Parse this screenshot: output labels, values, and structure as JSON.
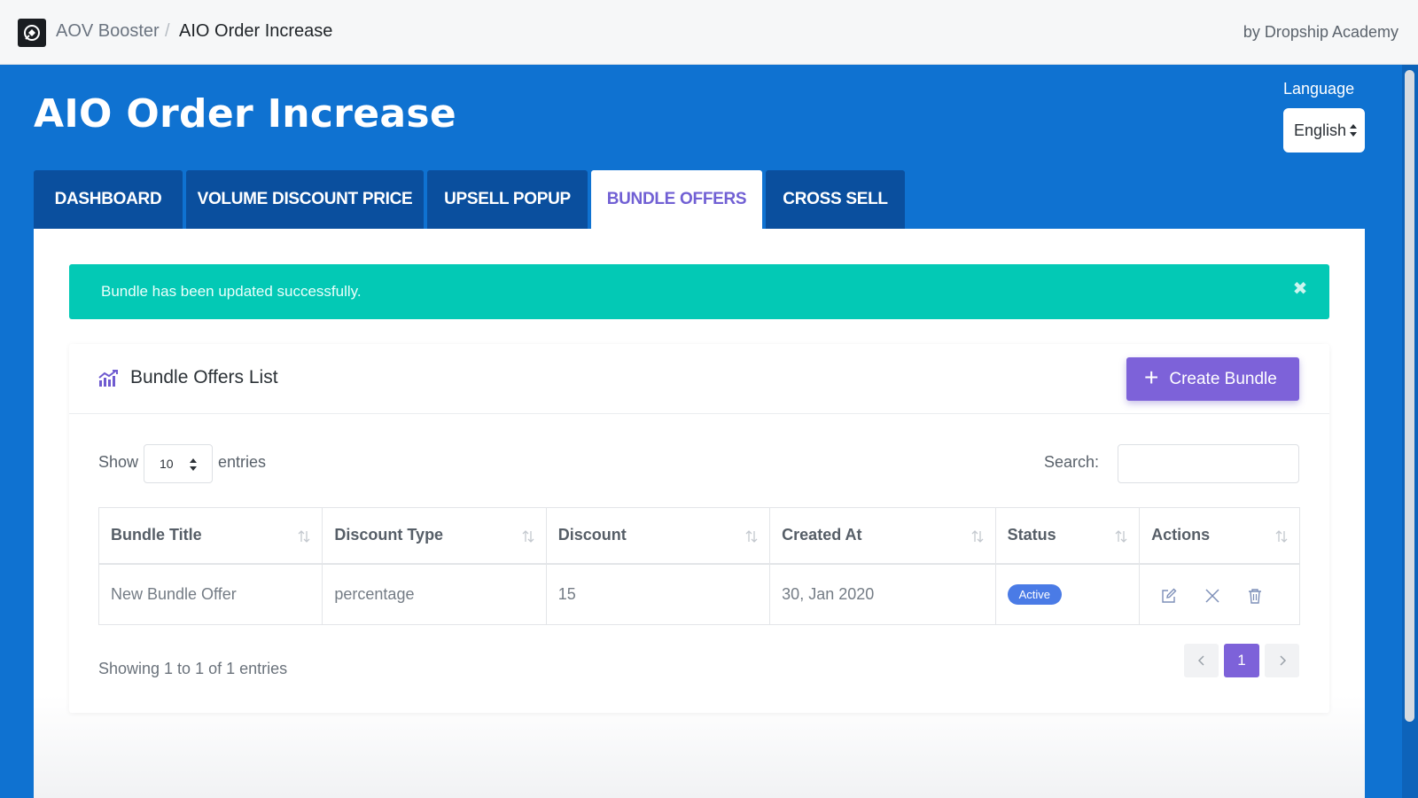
{
  "topbar": {
    "app_name": "AOV Booster",
    "separator": "/",
    "page_name": "AIO Order Increase",
    "by_text": "by Dropship Academy"
  },
  "header": {
    "title": "AIO Order Increase",
    "language_label": "Language",
    "language_value": "English"
  },
  "tabs": [
    {
      "label": "Dashboard",
      "active": false
    },
    {
      "label": "Volume Discount Price",
      "active": false
    },
    {
      "label": "Upsell Popup",
      "active": false
    },
    {
      "label": "Bundle Offers",
      "active": true
    },
    {
      "label": "Cross Sell",
      "active": false
    }
  ],
  "alert": {
    "message": "Bundle has been updated successfully.",
    "close_icon": "times-icon"
  },
  "card": {
    "title": "Bundle Offers List",
    "icon": "chart-icon",
    "create_button": "Create Bundle"
  },
  "table_controls": {
    "show_label": "Show",
    "entries_value": "10",
    "entries_label": "entries",
    "search_label": "Search:",
    "search_value": ""
  },
  "table": {
    "columns": [
      "Bundle Title",
      "Discount Type",
      "Discount",
      "Created At",
      "Status",
      "Actions"
    ],
    "rows": [
      {
        "title": "New Bundle Offer",
        "discount_type": "percentage",
        "discount": "15",
        "created_at": "30, Jan 2020",
        "status": "Active"
      }
    ]
  },
  "footer": {
    "showing": "Showing 1 to 1 of 1 entries",
    "current_page": "1"
  },
  "colors": {
    "brand_blue": "#0f72d1",
    "tab_dark": "#0a4f9e",
    "accent_purple": "#7d62d9",
    "alert_teal": "#03c9b5",
    "status_active": "#4a7be6"
  }
}
